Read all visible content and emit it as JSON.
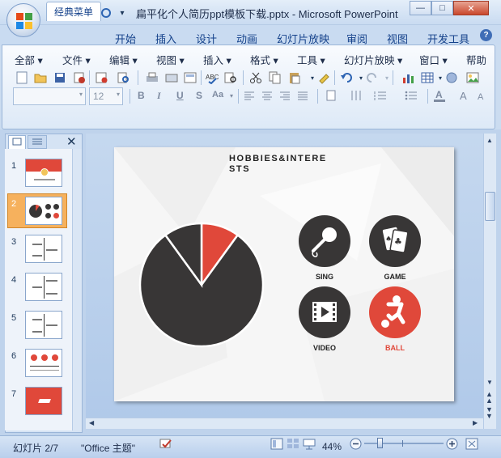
{
  "window": {
    "title": "扁平化个人简历ppt模板下载.pptx - Microsoft PowerPoint",
    "minimize": "—",
    "maximize": "□",
    "close": "✕"
  },
  "ribbon_tabs": [
    "经典菜单",
    "开始",
    "插入",
    "设计",
    "动画",
    "幻灯片放映",
    "审阅",
    "视图",
    "开发工具"
  ],
  "help": "?",
  "menu": [
    "全部",
    "文件",
    "编辑",
    "视图",
    "插入",
    "格式",
    "工具",
    "幻灯片放映",
    "窗口",
    "帮助"
  ],
  "font_size": "12",
  "format_buttons": [
    "B",
    "I",
    "U",
    "S",
    "Aa"
  ],
  "slides_panel": {
    "close": "✕",
    "numbers": [
      "1",
      "2",
      "3",
      "4",
      "5",
      "6",
      "7"
    ],
    "selected": 2
  },
  "slide": {
    "title": "HOBBIES&INTERE\nSTS",
    "pie_slices": [
      {
        "value": 80,
        "color": "#383636"
      },
      {
        "value": 10,
        "color": "#383636"
      },
      {
        "value": 10,
        "color": "#e0483a"
      }
    ],
    "hobbies": [
      {
        "label": "SING",
        "icon": "microphone-icon",
        "color": "#383636",
        "label_color": "#222222"
      },
      {
        "label": "GAME",
        "icon": "playing-cards-icon",
        "color": "#383636",
        "label_color": "#222222"
      },
      {
        "label": "VIDEO",
        "icon": "film-play-icon",
        "color": "#383636",
        "label_color": "#222222"
      },
      {
        "label": "BALL",
        "icon": "soccer-player-icon",
        "color": "#e0483a",
        "label_color": "#e0483a"
      }
    ]
  },
  "status": {
    "slide_pos": "幻灯片 2/7",
    "theme": "\"Office 主题\"",
    "zoom": "44%"
  },
  "colors": {
    "accent_red": "#e0483a",
    "dark": "#383636",
    "ribbon_blue": "#15428b"
  }
}
